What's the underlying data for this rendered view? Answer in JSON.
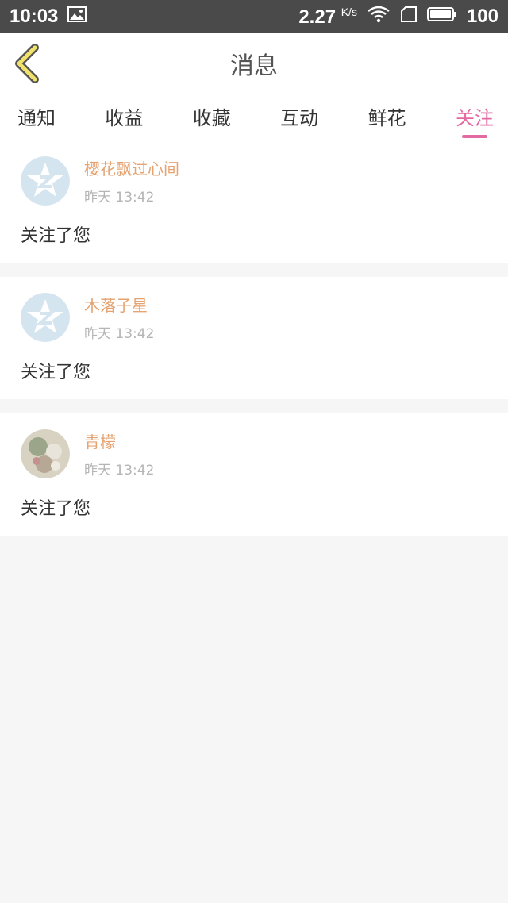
{
  "status_bar": {
    "time": "10:03",
    "speed": "2.27",
    "speed_unit": "K/s",
    "battery": "100"
  },
  "header": {
    "title": "消息"
  },
  "tabs": [
    "通知",
    "收益",
    "收藏",
    "互动",
    "鲜花",
    "关注"
  ],
  "active_tab": "关注",
  "messages": [
    {
      "username": "樱花飘过心间",
      "time": "昨天 13:42",
      "content": "关注了您"
    },
    {
      "username": "木落子星",
      "time": "昨天 13:42",
      "content": "关注了您"
    },
    {
      "username": "青檬",
      "time": "昨天 13:42",
      "content": "关注了您"
    }
  ],
  "colors": {
    "accent": "#e26aa0",
    "username": "#e5a372",
    "status_bar": "#4a4a4a"
  }
}
